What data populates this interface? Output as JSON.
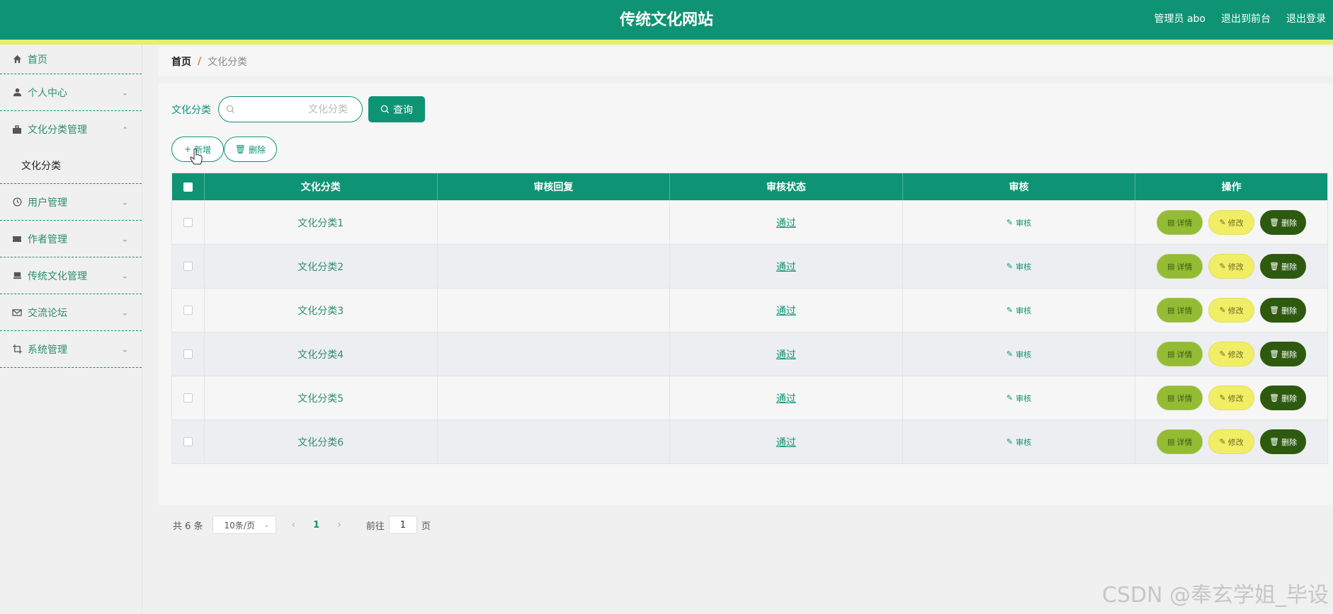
{
  "header": {
    "title": "传统文化网站",
    "admin_label": "管理员 abo",
    "back_label": "退出到前台",
    "logout_label": "退出登录"
  },
  "sidebar": {
    "items": [
      {
        "label": "首页",
        "icon": "home-icon"
      },
      {
        "label": "个人中心",
        "icon": "user-icon"
      },
      {
        "label": "文化分类管理",
        "icon": "briefcase-icon",
        "submenu": [
          {
            "label": "文化分类"
          }
        ]
      },
      {
        "label": "用户管理",
        "icon": "clock-icon"
      },
      {
        "label": "作者管理",
        "icon": "ticket-icon"
      },
      {
        "label": "传统文化管理",
        "icon": "tray-icon"
      },
      {
        "label": "交流论坛",
        "icon": "mail-icon"
      },
      {
        "label": "系统管理",
        "icon": "crop-icon"
      }
    ]
  },
  "breadcrumb": {
    "home": "首页",
    "separator": "/",
    "current": "文化分类"
  },
  "search": {
    "label": "文化分类",
    "placeholder": "文化分类",
    "button_label": "查询"
  },
  "toolbar": {
    "add_label": "新增",
    "delete_label": "删除"
  },
  "table": {
    "headers": [
      "文化分类",
      "审核回复",
      "审核状态",
      "审核",
      "操作"
    ],
    "rows": [
      {
        "category": "文化分类1",
        "reply": "",
        "status": "通过",
        "review": "审核"
      },
      {
        "category": "文化分类2",
        "reply": "",
        "status": "通过",
        "review": "审核"
      },
      {
        "category": "文化分类3",
        "reply": "",
        "status": "通过",
        "review": "审核"
      },
      {
        "category": "文化分类4",
        "reply": "",
        "status": "通过",
        "review": "审核"
      },
      {
        "category": "文化分类5",
        "reply": "",
        "status": "通过",
        "review": "审核"
      },
      {
        "category": "文化分类6",
        "reply": "",
        "status": "通过",
        "review": "审核"
      }
    ],
    "actions": {
      "detail": "详情",
      "edit": "修改",
      "delete": "删除"
    }
  },
  "pagination": {
    "total": "共 6 条",
    "page_size": "10条/页",
    "current_page": "1",
    "goto_label": "前往",
    "goto_value": "1",
    "page_suffix": "页"
  },
  "watermark": "CSDN @奉玄学姐_毕设",
  "colors": {
    "primary": "#0e9474",
    "accent_bar": "#e6ef6a",
    "detail_btn": "#94bb34",
    "edit_btn": "#f1ee66",
    "delete_btn": "#2d5a0f"
  }
}
